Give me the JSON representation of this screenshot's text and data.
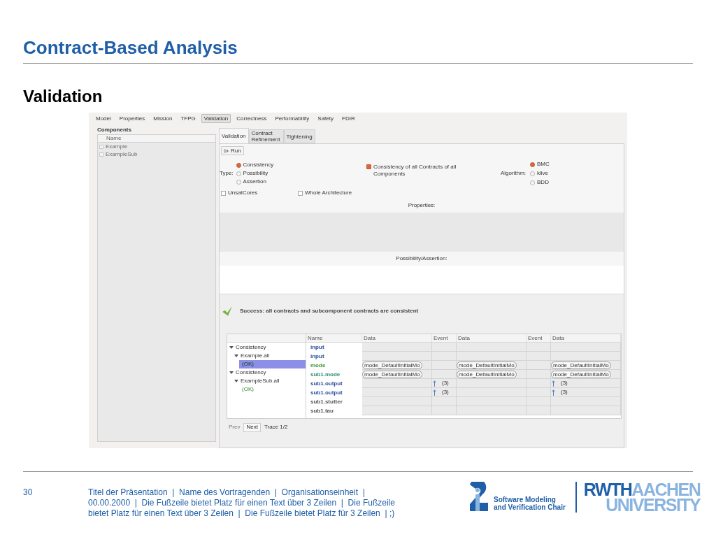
{
  "slide": {
    "title": "Contract-Based Analysis",
    "subtitle": "Validation"
  },
  "app": {
    "main_tabs": [
      {
        "label": "Model",
        "selected": false
      },
      {
        "label": "Properties",
        "selected": false
      },
      {
        "label": "Mission",
        "selected": false
      },
      {
        "label": "TFPG",
        "selected": false
      },
      {
        "label": "Validation",
        "selected": true
      },
      {
        "label": "Correctness",
        "selected": false
      },
      {
        "label": "Performability",
        "selected": false
      },
      {
        "label": "Safety",
        "selected": false
      },
      {
        "label": "FDIR",
        "selected": false
      }
    ],
    "components": {
      "title": "Components",
      "column": "Name",
      "items": [
        {
          "label": "Example",
          "checked": false
        },
        {
          "label": "ExampleSub",
          "checked": false
        }
      ]
    },
    "sub_tabs": [
      {
        "label": "Validation",
        "selected": true
      },
      {
        "label": "Contract Refinement",
        "selected": false
      },
      {
        "label": "Tightening",
        "selected": false
      }
    ],
    "run_button": "Run",
    "type": {
      "label": "Type:",
      "options": [
        {
          "label": "Consistency",
          "selected": true
        },
        {
          "label": "Possibility",
          "selected": false
        },
        {
          "label": "Assertion",
          "selected": false
        }
      ]
    },
    "all_contracts": {
      "label": "Consistency of all Contracts of all Components",
      "checked": true
    },
    "algorithm": {
      "label": "Algorithm:",
      "options": [
        {
          "label": "BMC",
          "selected": true
        },
        {
          "label": "klive",
          "selected": false
        },
        {
          "label": "BDD",
          "selected": false
        }
      ]
    },
    "options": [
      {
        "label": "UnsatCores",
        "checked": false
      },
      {
        "label": "Whole Architecture",
        "checked": false
      }
    ],
    "properties_label": "Properties:",
    "possibility_label": "Possibility/Assertion:",
    "result": {
      "message": "Success: all contracts and subcomponent contracts are consistent"
    },
    "trace": {
      "tree": [
        {
          "label": "Consistency",
          "expanded": true,
          "children": [
            {
              "label": "Example.all",
              "expanded": true,
              "children": [
                {
                  "label": "(OK)",
                  "selected": true
                }
              ]
            }
          ]
        },
        {
          "label": "Consistency",
          "expanded": true,
          "children": [
            {
              "label": "ExampleSub.all",
              "expanded": true,
              "children": [
                {
                  "label": "(OK)",
                  "selected": false
                }
              ]
            }
          ]
        }
      ],
      "columns": [
        "Name",
        "Data",
        "Event",
        "Data",
        "Event",
        "Data"
      ],
      "rows": [
        {
          "cells": [
            {
              "kind": "name",
              "text": "input",
              "color": "#2b4f9e"
            },
            {
              "kind": "blank"
            },
            {
              "kind": "blank"
            },
            {
              "kind": "blank"
            },
            {
              "kind": "blank"
            },
            {
              "kind": "blank"
            }
          ]
        },
        {
          "cells": [
            {
              "kind": "name",
              "text": "input",
              "color": "#2b4f9e"
            },
            {
              "kind": "blank"
            },
            {
              "kind": "blank"
            },
            {
              "kind": "blank"
            },
            {
              "kind": "blank"
            },
            {
              "kind": "blank"
            }
          ]
        },
        {
          "cells": [
            {
              "kind": "name",
              "text": "mode",
              "color": "#3a9a3a"
            },
            {
              "kind": "value",
              "text": "mode_DefaultInitialMo"
            },
            {
              "kind": "blank"
            },
            {
              "kind": "value",
              "text": "mode_DefaultInitialMo"
            },
            {
              "kind": "blank"
            },
            {
              "kind": "value",
              "text": "mode_DefaultInitialMo"
            }
          ]
        },
        {
          "cells": [
            {
              "kind": "name",
              "text": "sub1.mode",
              "color": "#2f8f7a"
            },
            {
              "kind": "value",
              "text": "mode_DefaultInitialMo"
            },
            {
              "kind": "blank"
            },
            {
              "kind": "value",
              "text": "mode_DefaultInitialMo"
            },
            {
              "kind": "blank"
            },
            {
              "kind": "value",
              "text": "mode_DefaultInitialMo"
            }
          ]
        },
        {
          "cells": [
            {
              "kind": "name",
              "text": "sub1.output",
              "color": "#2b4f9e"
            },
            {
              "kind": "blank"
            },
            {
              "kind": "event",
              "text": "(3)"
            },
            {
              "kind": "blank"
            },
            {
              "kind": "blank"
            },
            {
              "kind": "event",
              "text": "(3)"
            }
          ]
        },
        {
          "cells": [
            {
              "kind": "name",
              "text": "sub1.output",
              "color": "#2b4f9e"
            },
            {
              "kind": "blank"
            },
            {
              "kind": "event",
              "text": "(3)"
            },
            {
              "kind": "blank"
            },
            {
              "kind": "blank"
            },
            {
              "kind": "event",
              "text": "(3)"
            }
          ]
        },
        {
          "cells": [
            {
              "kind": "name",
              "text": "sub1.stutter",
              "color": "#555555"
            },
            {
              "kind": "blank"
            },
            {
              "kind": "blank"
            },
            {
              "kind": "blank"
            },
            {
              "kind": "blank"
            },
            {
              "kind": "blank"
            }
          ]
        },
        {
          "cells": [
            {
              "kind": "name",
              "text": "sub1.tau",
              "color": "#555555"
            },
            {
              "kind": "blank"
            },
            {
              "kind": "blank"
            },
            {
              "kind": "blank"
            },
            {
              "kind": "blank"
            },
            {
              "kind": "blank"
            }
          ]
        }
      ]
    },
    "nav": [
      {
        "label": "Prev",
        "disabled": true
      },
      {
        "label": "Next",
        "disabled": false
      }
    ],
    "trace_label": "Trace 1/2"
  },
  "footer": {
    "page": "30",
    "lines": [
      "Titel der Präsentation  |  Name des Vortragenden  |  Organisationseinheit  |",
      "00.00.2000  |  Die Fußzeile bietet Platz für einen Text über 3 Zeilen  |  Die Fußzeile",
      "bietet Platz für einen Text über 3 Zeilen  |  Die Fußzeile bietet Platz für 3 Zeilen  | ;)"
    ],
    "chair": [
      "Software Modeling",
      "and Verification Chair"
    ],
    "rwth": "RWTH",
    "aachen": "AACHEN",
    "university": "UNIVERSITY"
  }
}
